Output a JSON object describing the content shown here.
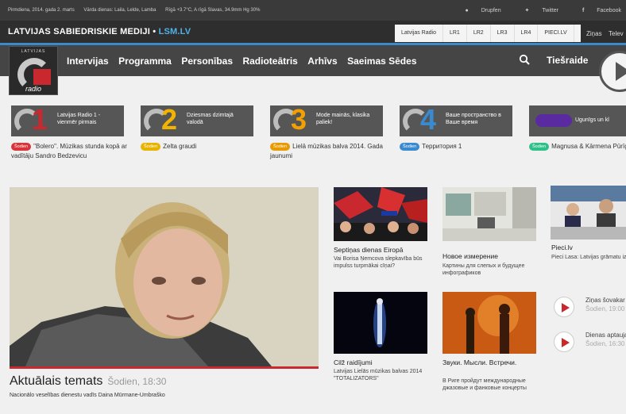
{
  "topbar": {
    "info": [
      "Pirmdiena, 2014. gada 2. marts",
      "Vārda dienas: Laila, Lelde, Lamba",
      "Rīgā +3.7°C, A rīgā Slavas, 34.9mm Hg 30%"
    ],
    "social": [
      "Drupfen",
      "Twitter",
      "Facebook"
    ]
  },
  "brand": {
    "name": "LATVIJAS SABIEDRISKIE MEDIJI",
    "site": "LSM.LV"
  },
  "radio_tabs": [
    "Latvijas Radio",
    "LR1",
    "LR2",
    "LR3",
    "LR4",
    "PIECI.LV"
  ],
  "brandbar_more": [
    "Ziņas",
    "Telev"
  ],
  "logo": {
    "top_text": "LATVIJAS",
    "bottom_text": "radio"
  },
  "nav": {
    "items": [
      "Intervijas",
      "Programma",
      "Personības",
      "Radioteātris",
      "Arhīvs",
      "Saeimas Sēdes"
    ],
    "live_label": "Tiešraide"
  },
  "channels": [
    {
      "num": "1",
      "color": "#c8282e",
      "title": "Latvijas Radio 1 - vienmēr pirmais",
      "badge": "Šodien",
      "badge_color": "#d8353b",
      "sub": "\"Bolero\". Mūzikas stunda kopā ar vadītāju Sandro Bedzevicu"
    },
    {
      "num": "2",
      "color": "#f2b400",
      "title": "Dziesmas dzimtajā valodā",
      "badge": "Šodien",
      "badge_color": "#e8b300",
      "sub": "Zelta graudi"
    },
    {
      "num": "3",
      "color": "#f2a000",
      "title": "Mode mainās, klasika paliek!",
      "badge": "Šodien",
      "badge_color": "#e89a00",
      "sub": "Lielā mūzikas balva 2014. Gada jaunumi"
    },
    {
      "num": "4",
      "color": "#3a8ad0",
      "title": "Ваше пространство в Ваше время",
      "badge": "Šodien",
      "badge_color": "#3a8ad0",
      "sub": "Территория 1"
    },
    {
      "num": "",
      "color": "#5a2aa0",
      "title": "Ugunīgs un kl",
      "badge": "Šodien",
      "badge_color": "#2fc08a",
      "sub": "Magnusa & Kārmena Pūrīgs vakars"
    }
  ],
  "feature": {
    "title": "Aktuālais temats",
    "time": "Šodien, 18:30",
    "subtitle": "Nacionālo veselības dienestu vadīs Daina Mūrmane-Umbraško"
  },
  "cards": [
    {
      "title": "Septiņas dienas Eiropā",
      "sub": "Vai Borisa Ņemcova slepkavība būs impulss turpmākai cīņai?"
    },
    {
      "title": "Новое измерение",
      "sub": "Картины для слепых и будущее инфографиков"
    },
    {
      "title": "Pieci.lv",
      "sub": "Pieci Lasa: Latvijas grāmatu izstāde & J.Z \"Pēkšņa skriein debese"
    },
    {
      "title": "Cilž raidījumi",
      "sub": "Latvijas Lielās mūzikas balvas 2014 \"TOTALIZATORS\""
    },
    {
      "title": "Звуки. Мысли. Встречи.",
      "sub": "В Риге пройдут международные джазовые и фанковые концерты"
    }
  ],
  "list_items": [
    {
      "title": "Ziņas šovakar",
      "time": "Šodien, 19:00"
    },
    {
      "title": "Dienas aptauja",
      "time": "Šodien, 16:30"
    }
  ]
}
